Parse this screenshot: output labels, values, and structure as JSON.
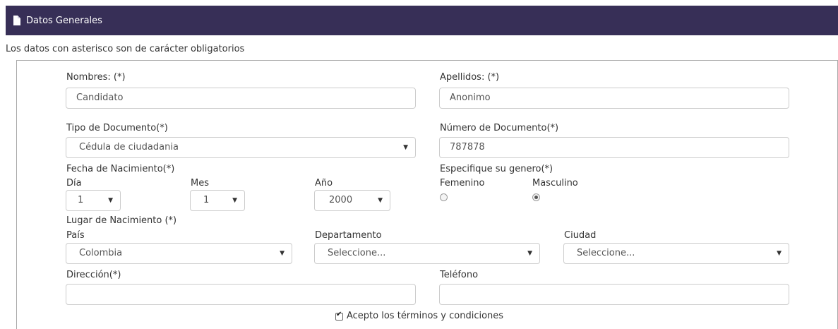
{
  "header": {
    "title": "Datos Generales",
    "icon": "document-icon"
  },
  "note": "Los datos con asterisco son de carácter obligatorios",
  "form": {
    "nombres": {
      "label": "Nombres: (*)",
      "value": "Candidato"
    },
    "apellidos": {
      "label": "Apellidos: (*)",
      "value": "Anonimo"
    },
    "tipo_documento": {
      "label": "Tipo de Documento(*)",
      "selected": "Cédula de ciudadania"
    },
    "numero_documento": {
      "label": "Número de Documento(*)",
      "value": "787878"
    },
    "fecha_nacimiento": {
      "label": "Fecha de Nacimiento(*)",
      "dia": {
        "label": "Día",
        "selected": "1"
      },
      "mes": {
        "label": "Mes",
        "selected": "1"
      },
      "anio": {
        "label": "Año",
        "selected": "2000"
      }
    },
    "genero": {
      "label": "Especifique su genero(*)",
      "options": [
        {
          "label": "Femenino",
          "checked": false
        },
        {
          "label": "Masculino",
          "checked": true
        }
      ]
    },
    "lugar_nacimiento": {
      "label": "Lugar de Nacimiento (*)",
      "pais": {
        "label": "País",
        "selected": "Colombia"
      },
      "departamento": {
        "label": "Departamento",
        "selected": "Seleccione..."
      },
      "ciudad": {
        "label": "Ciudad",
        "selected": "Seleccione..."
      }
    },
    "direccion": {
      "label": "Dirección(*)",
      "value": ""
    },
    "telefono": {
      "label": "Teléfono",
      "value": ""
    },
    "terminos": {
      "label": "Acepto los términos y condiciones",
      "checked": true
    }
  },
  "colors": {
    "header_bg": "#372f57",
    "border": "#a9a9a9"
  }
}
